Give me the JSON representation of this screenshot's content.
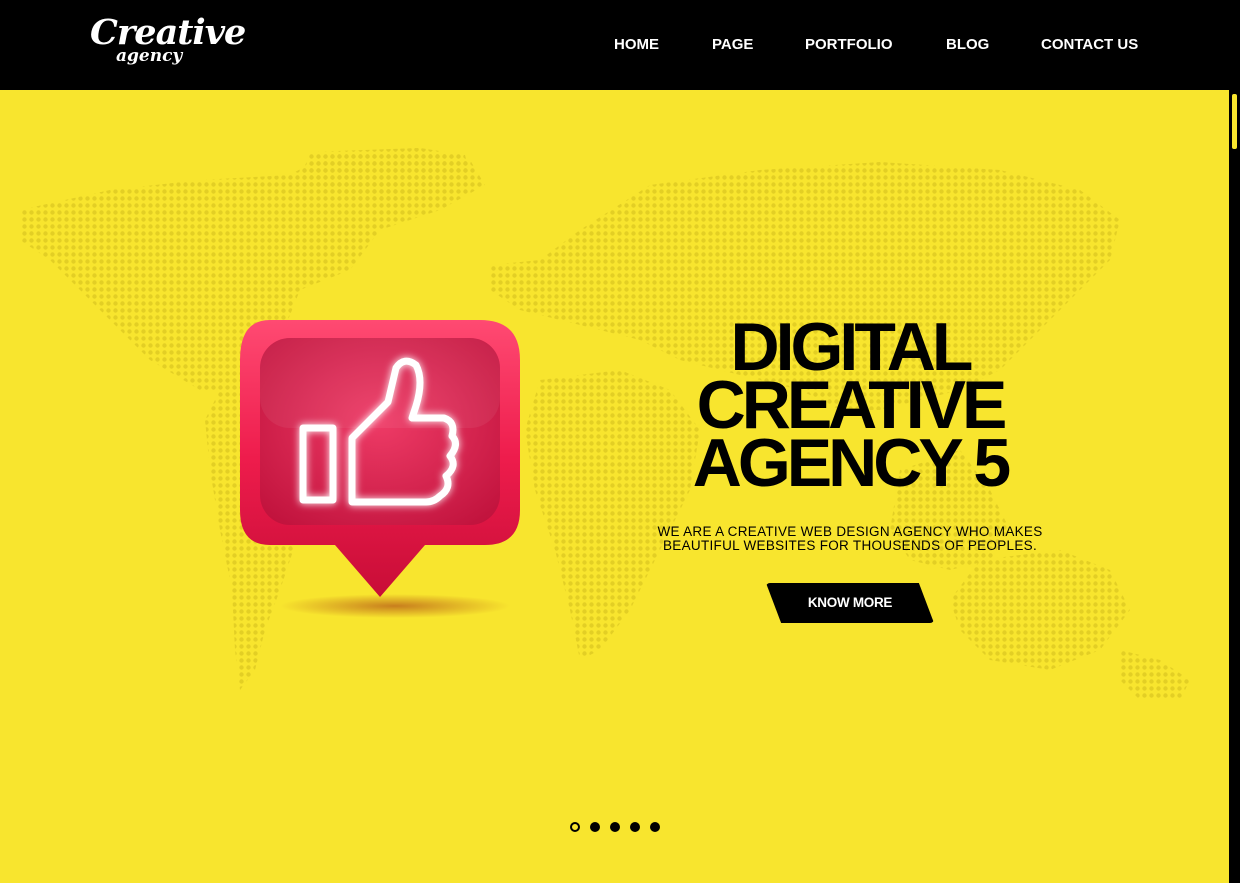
{
  "brand": {
    "logo_line1": "Creative",
    "logo_line2": "agency"
  },
  "nav": [
    {
      "label": "HOME"
    },
    {
      "label": "PAGE"
    },
    {
      "label": "PORTFOLIO"
    },
    {
      "label": "BLOG"
    },
    {
      "label": "CONTACT US"
    }
  ],
  "hero": {
    "title_lines": [
      "DIGITAL",
      "CREATIVE",
      "AGENCY 5"
    ],
    "subtitle_lines": [
      "WE ARE A CREATIVE WEB DESIGN AGENCY WHO MAKES",
      "BEAUTIFUL WEBSITES FOR THOUSENDS OF PEOPLES."
    ],
    "cta_label": "KNOW MORE",
    "illustration_icon": "thumbs-up-icon"
  },
  "slider": {
    "slide_count": 5,
    "active_index": 0
  },
  "colors": {
    "background": "#f8e52e",
    "header": "#000000",
    "badge_red": "#ee1c4c",
    "neon": "#ffffff",
    "map_dots": "#e5d226"
  }
}
